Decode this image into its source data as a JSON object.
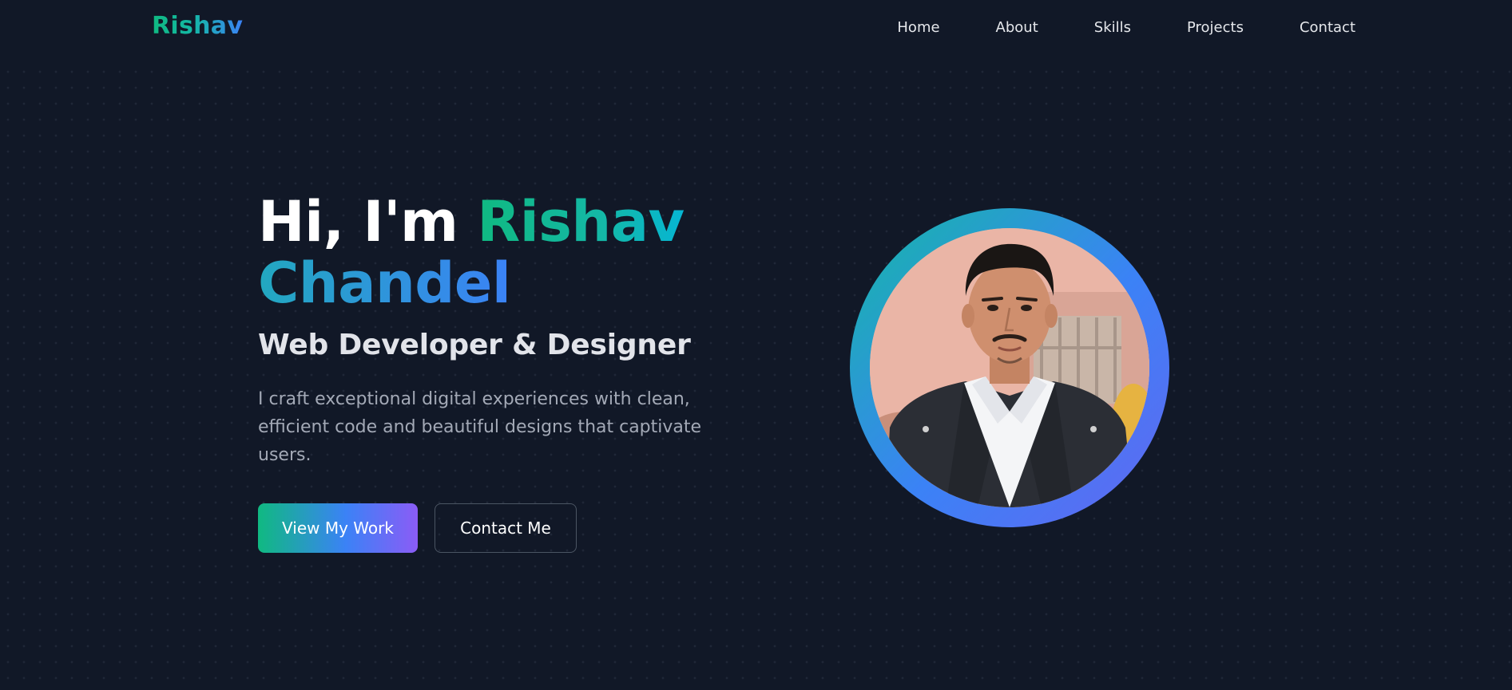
{
  "brand": {
    "logo": "Rishav"
  },
  "nav": {
    "items": [
      {
        "label": "Home"
      },
      {
        "label": "About"
      },
      {
        "label": "Skills"
      },
      {
        "label": "Projects"
      },
      {
        "label": "Contact"
      }
    ]
  },
  "hero": {
    "greeting": "Hi, I'm ",
    "first_name": "Rishav",
    "last_name": "Chandel",
    "subtitle": "Web Developer & Designer",
    "description": "I craft exceptional digital experiences with clean, efficient code and beautiful designs that captivate users.",
    "primary_button": "View My Work",
    "secondary_button": "Contact Me"
  },
  "colors": {
    "background": "#111827",
    "accent_green": "#10b981",
    "accent_blue": "#3b82f6",
    "accent_purple": "#8b5cf6"
  }
}
